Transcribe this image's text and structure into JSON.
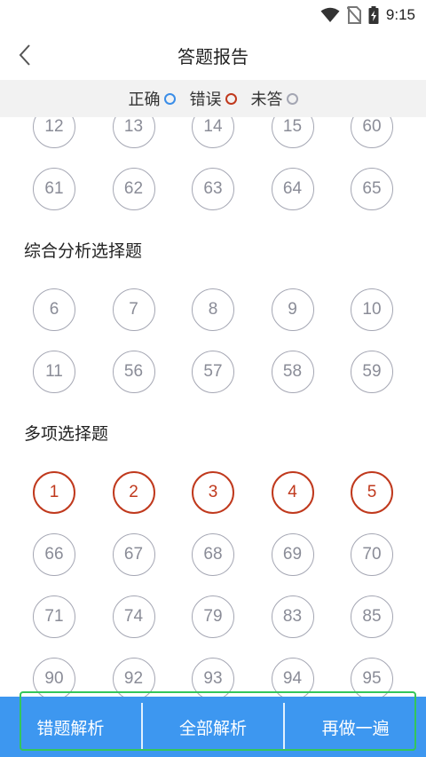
{
  "status": {
    "time": "9:15"
  },
  "header": {
    "title": "答题报告"
  },
  "legend": [
    {
      "label": "正确",
      "color": "#3b8ee8"
    },
    {
      "label": "错误",
      "color": "#c0391d"
    },
    {
      "label": "未答",
      "color": "#a4a6b3"
    }
  ],
  "questions": {
    "row_top_partial": [
      "12",
      "13",
      "14",
      "15",
      "60"
    ],
    "row_top_2": [
      "61",
      "62",
      "63",
      "64",
      "65"
    ],
    "section_1": {
      "title": "综合分析选择题",
      "rows": [
        [
          "6",
          "7",
          "8",
          "9",
          "10"
        ],
        [
          "11",
          "56",
          "57",
          "58",
          "59"
        ]
      ]
    },
    "section_2": {
      "title": "多项选择题",
      "rows": [
        [
          "1",
          "2",
          "3",
          "4",
          "5"
        ],
        [
          "66",
          "67",
          "68",
          "69",
          "70"
        ],
        [
          "71",
          "74",
          "79",
          "83",
          "85"
        ],
        [
          "90",
          "92",
          "93",
          "94",
          "95"
        ]
      ],
      "wrong_row_index": 0
    }
  },
  "bottom": {
    "wrong_analysis": "错题解析",
    "all_analysis": "全部解析",
    "redo": "再做一遍"
  },
  "colors": {
    "accent": "#3d97f0",
    "wrong": "#c0391d",
    "unanswered": "#a4a6b3",
    "highlight": "#34c65a"
  }
}
